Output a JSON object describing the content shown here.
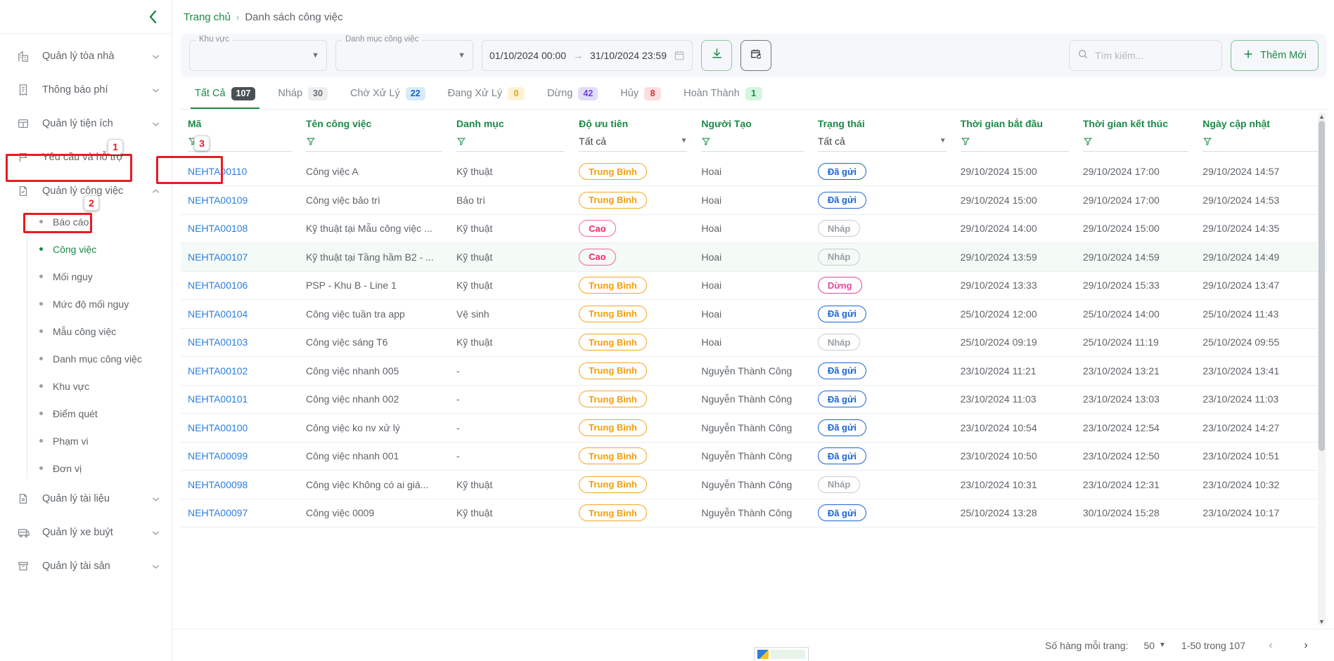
{
  "sidebar": {
    "collapse_icon": "chevron-left-icon",
    "items": [
      {
        "label": "Quản lý tòa nhà",
        "icon": "building-icon",
        "caret": "chevron-down-icon"
      },
      {
        "label": "Thông báo phí",
        "icon": "receipt-icon",
        "caret": "chevron-down-icon"
      },
      {
        "label": "Quản lý tiện ích",
        "icon": "layout-icon",
        "caret": "chevron-down-icon"
      },
      {
        "label": "Yêu cầu và hỗ trợ",
        "icon": "flag-icon",
        "caret": ""
      },
      {
        "label": "Quản lý công việc",
        "icon": "task-doc-icon",
        "caret": "chevron-up-icon"
      }
    ],
    "sub_items": [
      {
        "label": "Báo cáo"
      },
      {
        "label": "Công việc"
      },
      {
        "label": "Mối nguy"
      },
      {
        "label": "Mức độ mối nguy"
      },
      {
        "label": "Mẫu công việc"
      },
      {
        "label": "Danh mục công việc"
      },
      {
        "label": "Khu vực"
      },
      {
        "label": "Điểm quét"
      },
      {
        "label": "Phạm vi"
      },
      {
        "label": "Đơn vị"
      }
    ],
    "items_bottom": [
      {
        "label": "Quản lý tài liệu",
        "icon": "document-icon",
        "caret": "chevron-down-icon"
      },
      {
        "label": "Quản lý xe buýt",
        "icon": "bus-icon",
        "caret": "chevron-down-icon"
      },
      {
        "label": "Quản lý tài sản",
        "icon": "archive-icon",
        "caret": "chevron-down-icon"
      }
    ],
    "annotations": [
      {
        "number": "1"
      },
      {
        "number": "2"
      },
      {
        "number": "3"
      }
    ]
  },
  "breadcrumb": {
    "home": "Trang chủ",
    "separator": "›",
    "current": "Danh sách công việc"
  },
  "filters": {
    "area": {
      "label": "Khu vực",
      "value": ""
    },
    "category": {
      "label": "Danh mục công việc",
      "value": ""
    },
    "date_from": "01/10/2024 00:00",
    "date_arrow": "→",
    "date_to": "31/10/2024 23:59",
    "calendar_icon": "calendar-icon",
    "download_icon": "download-icon",
    "history_icon": "calendar-refresh-icon",
    "search": {
      "placeholder": "Tìm kiếm...",
      "value": "",
      "icon": "search-icon"
    },
    "add_button": {
      "label": "Thêm Mới",
      "icon": "plus-icon"
    }
  },
  "tabs": [
    {
      "label": "Tất Cả",
      "count": "107",
      "chip_bg": "#4a4f54",
      "chip_fg": "#ffffff"
    },
    {
      "label": "Nháp",
      "count": "30",
      "chip_bg": "#eceef0",
      "chip_fg": "#6b7076"
    },
    {
      "label": "Chờ Xử Lý",
      "count": "22",
      "chip_bg": "#d7ebfb",
      "chip_fg": "#1a64d6"
    },
    {
      "label": "Đang Xử Lý",
      "count": "0",
      "chip_bg": "#fdf3d4",
      "chip_fg": "#e8a020"
    },
    {
      "label": "Dừng",
      "count": "42",
      "chip_bg": "#e3ddf8",
      "chip_fg": "#6d3fe0"
    },
    {
      "label": "Hủy",
      "count": "8",
      "chip_bg": "#fbdede",
      "chip_fg": "#e02b2b"
    },
    {
      "label": "Hoàn Thành",
      "count": "1",
      "chip_bg": "#d4f5de",
      "chip_fg": "#1a8a47"
    }
  ],
  "table": {
    "columns": [
      {
        "header": "Mã",
        "filter_type": "icon"
      },
      {
        "header": "Tên công việc",
        "filter_type": "icon"
      },
      {
        "header": "Danh mục",
        "filter_type": "icon"
      },
      {
        "header": "Độ ưu tiên",
        "filter_type": "select",
        "filter_value": "Tất cả"
      },
      {
        "header": "Người Tạo",
        "filter_type": "icon"
      },
      {
        "header": "Trạng thái",
        "filter_type": "select",
        "filter_value": "Tất cả"
      },
      {
        "header": "Thời gian bắt đầu",
        "filter_type": "icon"
      },
      {
        "header": "Thời gian kết thúc",
        "filter_type": "icon"
      },
      {
        "header": "Ngày cập nhật",
        "filter_type": "icon"
      }
    ],
    "rows": [
      {
        "code": "NEHTA00110",
        "name": "Công việc A",
        "category": "Kỹ thuật",
        "priority": "Trung Bình",
        "priority_style": "pri-mid",
        "creator": "Hoai",
        "status": "Đã gửi",
        "status_style": "pill-blue",
        "start": "29/10/2024 15:00",
        "end": "29/10/2024 17:00",
        "updated": "29/10/2024 14:57"
      },
      {
        "code": "NEHTA00109",
        "name": "Công việc bảo trì",
        "category": "Bảo trì",
        "priority": "Trung Bình",
        "priority_style": "pri-mid",
        "creator": "Hoai",
        "status": "Đã gửi",
        "status_style": "pill-blue",
        "start": "29/10/2024 15:00",
        "end": "29/10/2024 17:00",
        "updated": "29/10/2024 14:53"
      },
      {
        "code": "NEHTA00108",
        "name": "Kỹ thuật tại Mẫu công việc ...",
        "category": "Kỹ thuật",
        "priority": "Cao",
        "priority_style": "pri-high",
        "creator": "Hoai",
        "status": "Nháp",
        "status_style": "pill-grey",
        "start": "29/10/2024 14:00",
        "end": "29/10/2024 15:00",
        "updated": "29/10/2024 14:35"
      },
      {
        "code": "NEHTA00107",
        "name": "Kỹ thuật tại Tầng hầm B2 - ...",
        "category": "Kỹ thuật",
        "priority": "Cao",
        "priority_style": "pri-high",
        "creator": "Hoai",
        "status": "Nháp",
        "status_style": "pill-grey",
        "start": "29/10/2024 13:59",
        "end": "29/10/2024 14:59",
        "updated": "29/10/2024 14:49"
      },
      {
        "code": "NEHTA00106",
        "name": "PSP - Khu B - Line 1",
        "category": "Kỹ thuật",
        "priority": "Trung Bình",
        "priority_style": "pri-mid",
        "creator": "Hoai",
        "status": "Dừng",
        "status_style": "pill-pink",
        "start": "29/10/2024 13:33",
        "end": "29/10/2024 15:33",
        "updated": "29/10/2024 13:47"
      },
      {
        "code": "NEHTA00104",
        "name": "Công việc tuần tra app",
        "category": "Vệ sinh",
        "priority": "Trung Bình",
        "priority_style": "pri-mid",
        "creator": "Hoai",
        "status": "Đã gửi",
        "status_style": "pill-blue",
        "start": "25/10/2024 12:00",
        "end": "25/10/2024 14:00",
        "updated": "25/10/2024 11:43"
      },
      {
        "code": "NEHTA00103",
        "name": "Công việc sáng T6",
        "category": "Kỹ thuật",
        "priority": "Trung Bình",
        "priority_style": "pri-mid",
        "creator": "Hoai",
        "status": "Nháp",
        "status_style": "pill-grey",
        "start": "25/10/2024 09:19",
        "end": "25/10/2024 11:19",
        "updated": "25/10/2024 09:55"
      },
      {
        "code": "NEHTA00102",
        "name": "Công việc nhanh 005",
        "category": "-",
        "priority": "Trung Bình",
        "priority_style": "pri-mid",
        "creator": "Nguyễn Thành Công",
        "status": "Đã gửi",
        "status_style": "pill-blue",
        "start": "23/10/2024 11:21",
        "end": "23/10/2024 13:21",
        "updated": "23/10/2024 13:41"
      },
      {
        "code": "NEHTA00101",
        "name": "Công việc nhanh 002",
        "category": "-",
        "priority": "Trung Bình",
        "priority_style": "pri-mid",
        "creator": "Nguyễn Thành Công",
        "status": "Đã gửi",
        "status_style": "pill-blue",
        "start": "23/10/2024 11:03",
        "end": "23/10/2024 13:03",
        "updated": "23/10/2024 11:03"
      },
      {
        "code": "NEHTA00100",
        "name": "Công việc ko nv xử lý",
        "category": "-",
        "priority": "Trung Bình",
        "priority_style": "pri-mid",
        "creator": "Nguyễn Thành Công",
        "status": "Đã gửi",
        "status_style": "pill-blue",
        "start": "23/10/2024 10:54",
        "end": "23/10/2024 12:54",
        "updated": "23/10/2024 14:27"
      },
      {
        "code": "NEHTA00099",
        "name": "Công việc nhanh 001",
        "category": "-",
        "priority": "Trung Bình",
        "priority_style": "pri-mid",
        "creator": "Nguyễn Thành Công",
        "status": "Đã gửi",
        "status_style": "pill-blue",
        "start": "23/10/2024 10:50",
        "end": "23/10/2024 12:50",
        "updated": "23/10/2024 10:51"
      },
      {
        "code": "NEHTA00098",
        "name": "Công việc Không có ai giá...",
        "category": "Kỹ thuật",
        "priority": "Trung Bình",
        "priority_style": "pri-mid",
        "creator": "Nguyễn Thành Công",
        "status": "Nháp",
        "status_style": "pill-grey",
        "start": "23/10/2024 10:31",
        "end": "23/10/2024 12:31",
        "updated": "23/10/2024 10:32"
      },
      {
        "code": "NEHTA00097",
        "name": "Công việc 0009",
        "category": "Kỹ thuật",
        "priority": "Trung Bình",
        "priority_style": "pri-mid",
        "creator": "Nguyễn Thành Công",
        "status": "Đã gửi",
        "status_style": "pill-blue",
        "start": "25/10/2024 13:28",
        "end": "30/10/2024 15:28",
        "updated": "23/10/2024 10:17"
      }
    ]
  },
  "footer": {
    "rows_label": "Số hàng mỗi trang:",
    "rows_value": "50",
    "range": "1-50 trong 107",
    "prev_icon": "chevron-left-icon",
    "next_icon": "chevron-right-icon"
  },
  "colors": {
    "brand_green": "#1a8a47",
    "link_blue": "#2b7fe0",
    "annotation_red": "#e81b23"
  }
}
